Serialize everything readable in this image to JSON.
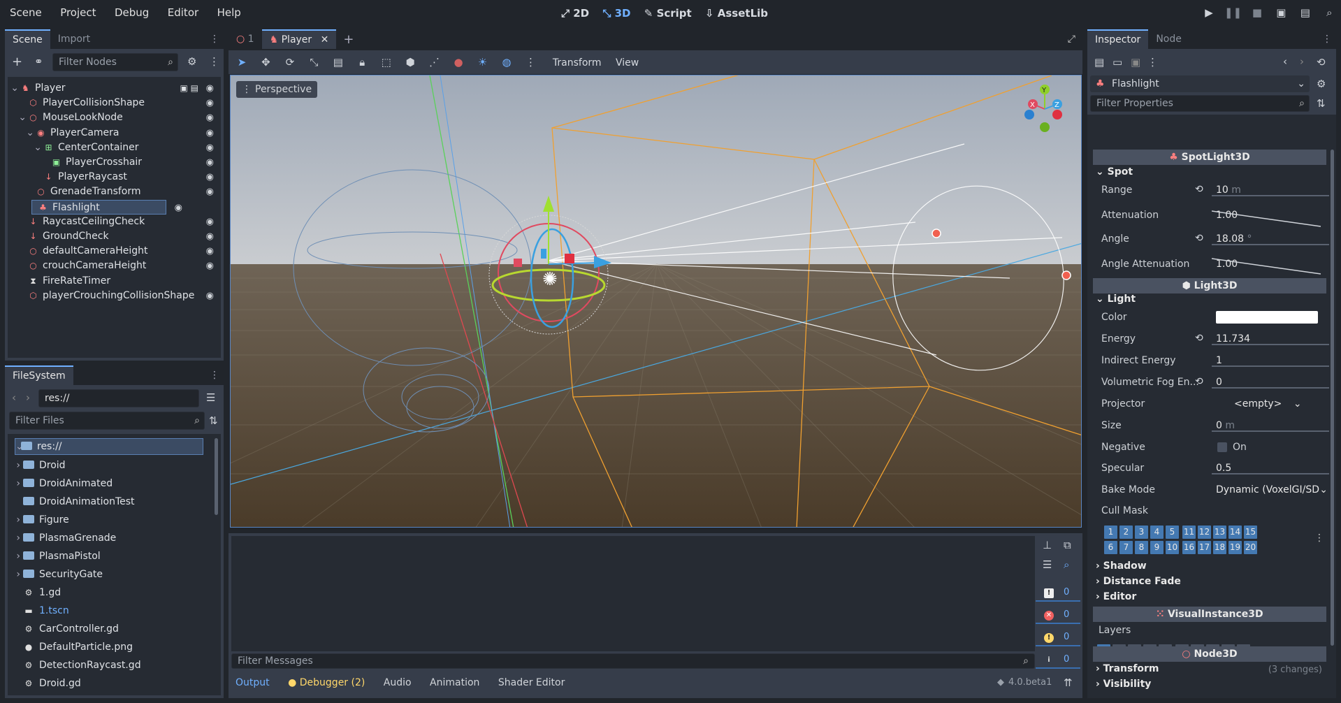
{
  "menu": [
    "Scene",
    "Project",
    "Debug",
    "Editor",
    "Help"
  ],
  "modes": [
    {
      "icon": "2d-icon",
      "label": "2D",
      "active": false
    },
    {
      "icon": "3d-icon",
      "label": "3D",
      "active": true
    },
    {
      "icon": "script-icon",
      "label": "Script",
      "active": false
    },
    {
      "icon": "assetlib-icon",
      "label": "AssetLib",
      "active": false
    }
  ],
  "scene_dock": {
    "tabs": [
      "Scene",
      "Import"
    ],
    "filter_placeholder": "Filter Nodes",
    "nodes": [
      {
        "name": "Player",
        "depth": 0,
        "icon": "character-icon",
        "color": "red"
      },
      {
        "name": "PlayerCollisionShape",
        "depth": 1,
        "icon": "collision-shape-icon",
        "color": "red"
      },
      {
        "name": "MouseLookNode",
        "depth": 1,
        "icon": "node3d-icon",
        "color": "red"
      },
      {
        "name": "PlayerCamera",
        "depth": 2,
        "icon": "camera-icon",
        "color": "red"
      },
      {
        "name": "CenterContainer",
        "depth": 3,
        "icon": "container-icon",
        "color": "green"
      },
      {
        "name": "PlayerCrosshair",
        "depth": 4,
        "icon": "texture-rect-icon",
        "color": "green"
      },
      {
        "name": "PlayerRaycast",
        "depth": 3,
        "icon": "raycast-icon",
        "color": "red"
      },
      {
        "name": "GrenadeTransform",
        "depth": 2,
        "icon": "node3d-icon",
        "color": "red"
      },
      {
        "name": "Flashlight",
        "depth": 2,
        "icon": "spotlight-icon",
        "color": "red"
      },
      {
        "name": "RaycastCeilingCheck",
        "depth": 1,
        "icon": "raycast-icon",
        "color": "red"
      },
      {
        "name": "GroundCheck",
        "depth": 1,
        "icon": "raycast-icon",
        "color": "red"
      },
      {
        "name": "defaultCameraHeight",
        "depth": 1,
        "icon": "node3d-icon",
        "color": "red"
      },
      {
        "name": "crouchCameraHeight",
        "depth": 1,
        "icon": "node3d-icon",
        "color": "red"
      },
      {
        "name": "FireRateTimer",
        "depth": 1,
        "icon": "timer-icon",
        "color": "white"
      },
      {
        "name": "playerCrouchingCollisionShape",
        "depth": 1,
        "icon": "collision-shape-icon",
        "color": "red"
      }
    ]
  },
  "filesystem": {
    "tab": "FileSystem",
    "path": "res://",
    "filter_placeholder": "Filter Files",
    "items": [
      {
        "name": "res://",
        "type": "root"
      },
      {
        "name": "Droid",
        "type": "folder"
      },
      {
        "name": "DroidAnimated",
        "type": "folder"
      },
      {
        "name": "DroidAnimationTest",
        "type": "folder"
      },
      {
        "name": "Figure",
        "type": "folder"
      },
      {
        "name": "PlasmaGrenade",
        "type": "folder"
      },
      {
        "name": "PlasmaPistol",
        "type": "folder"
      },
      {
        "name": "SecurityGate",
        "type": "folder"
      },
      {
        "name": "1.gd",
        "type": "script"
      },
      {
        "name": "1.tscn",
        "type": "scene"
      },
      {
        "name": "CarController.gd",
        "type": "script"
      },
      {
        "name": "DefaultParticle.png",
        "type": "image"
      },
      {
        "name": "DetectionRaycast.gd",
        "type": "script"
      },
      {
        "name": "Droid.gd",
        "type": "script"
      }
    ]
  },
  "editor_tabs": [
    {
      "label": "1",
      "active": false
    },
    {
      "label": "Player",
      "active": true
    }
  ],
  "viewport_toolbar": {
    "transform": "Transform",
    "view": "View"
  },
  "viewport": {
    "perspective": "Perspective",
    "gizmo_axes": [
      "Y",
      "X",
      "Z"
    ]
  },
  "output": {
    "filter_placeholder": "Filter Messages",
    "counts": [
      "0",
      "0",
      "0",
      "0"
    ],
    "tabs": [
      "Output",
      "Debugger (2)",
      "Audio",
      "Animation",
      "Shader Editor"
    ],
    "version": "4.0.beta1"
  },
  "inspector": {
    "tabs": [
      "Inspector",
      "Node"
    ],
    "object": "Flashlight",
    "filter_placeholder": "Filter Properties",
    "spot_class": "SpotLight3D",
    "spot_section": "Spot",
    "range": {
      "label": "Range",
      "value": "10",
      "unit": "m"
    },
    "attenuation": {
      "label": "Attenuation",
      "value": "1.00"
    },
    "angle": {
      "label": "Angle",
      "value": "18.08",
      "unit": "°"
    },
    "angle_attenuation": {
      "label": "Angle Attenuation",
      "value": "1.00"
    },
    "light_class": "Light3D",
    "light_section": "Light",
    "color_label": "Color",
    "energy": {
      "label": "Energy",
      "value": "11.734"
    },
    "indirect_energy": {
      "label": "Indirect Energy",
      "value": "1"
    },
    "volumetric": {
      "label": "Volumetric Fog En...",
      "value": "0"
    },
    "projector": {
      "label": "Projector",
      "value": "<empty>"
    },
    "size": {
      "label": "Size",
      "value": "0",
      "unit": "m"
    },
    "negative": {
      "label": "Negative",
      "value": "On"
    },
    "specular": {
      "label": "Specular",
      "value": "0.5"
    },
    "bake_mode": {
      "label": "Bake Mode",
      "value": "Dynamic (VoxelGI/SD"
    },
    "cull_mask_label": "Cull Mask",
    "collapsed": [
      "Shadow",
      "Distance Fade",
      "Editor"
    ],
    "visual_class": "VisualInstance3D",
    "layers_label": "Layers",
    "node3d_class": "Node3D",
    "transform": {
      "label": "Transform",
      "note": "(3 changes)"
    },
    "visibility": "Visibility",
    "grid_row1": [
      "1",
      "2",
      "3",
      "4",
      "5",
      "11",
      "12",
      "13",
      "14",
      "15"
    ],
    "grid_row2": [
      "6",
      "7",
      "8",
      "9",
      "10",
      "16",
      "17",
      "18",
      "19",
      "20"
    ]
  },
  "colors": {
    "accent": "#70b0ff",
    "node_red": "#fc7f7f",
    "node_green": "#8eef97"
  }
}
